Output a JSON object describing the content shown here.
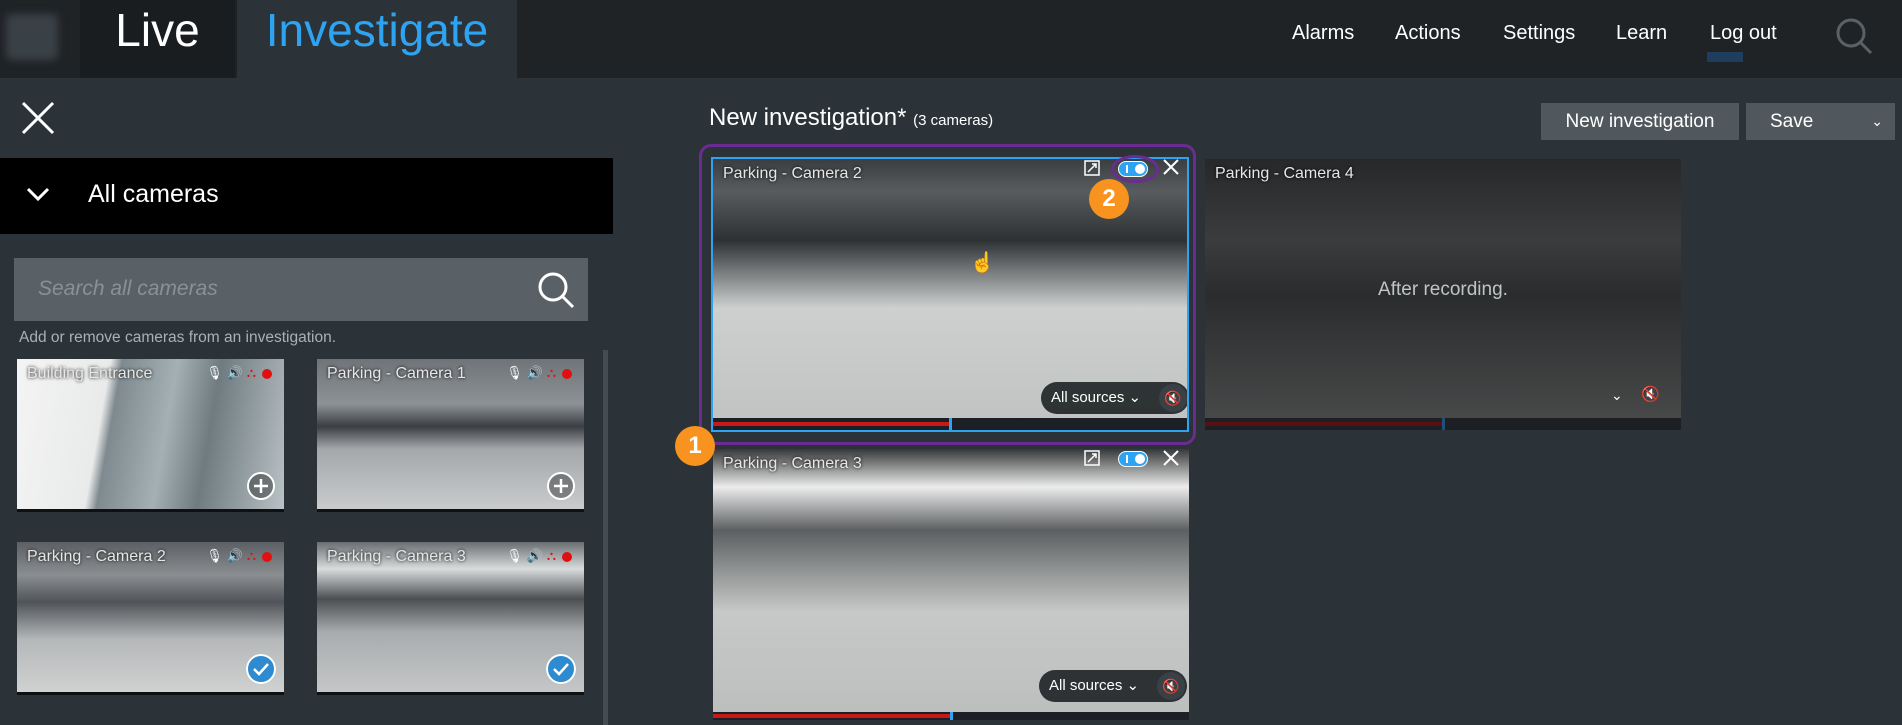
{
  "topbar": {
    "tabs": [
      {
        "label": "Live"
      },
      {
        "label": "Investigate"
      }
    ],
    "nav": {
      "alarms": "Alarms",
      "actions": "Actions",
      "settings": "Settings",
      "learn": "Learn",
      "logout": "Log out"
    }
  },
  "sidebar": {
    "header": "All cameras",
    "search_placeholder": "Search all cameras",
    "hint": "Add or remove cameras from an investigation.",
    "cameras": [
      {
        "name": "Building Entrance",
        "status": "add"
      },
      {
        "name": "Parking - Camera 1",
        "status": "add"
      },
      {
        "name": "Parking - Camera 2",
        "status": "added"
      },
      {
        "name": "Parking - Camera 3",
        "status": "added"
      }
    ]
  },
  "investigation": {
    "title": "New investigation*",
    "subtitle": "(3 cameras)",
    "new_button": "New investigation",
    "save_button": "Save",
    "views": [
      {
        "name": "Parking - Camera 2",
        "sources": "All sources ⌄",
        "playback_fraction": 0.5
      },
      {
        "name": "Parking - Camera 4",
        "overlay": "After recording.",
        "playback_fraction": 0.5
      },
      {
        "name": "Parking - Camera 3",
        "sources": "All sources ⌄",
        "playback_fraction": 0.5
      }
    ]
  },
  "callouts": {
    "one": "1",
    "two": "2"
  },
  "colors": {
    "accent": "#2ea3f2",
    "callout": "#f7931e",
    "highlight": "#6b2c91",
    "recording": "#e01010"
  }
}
